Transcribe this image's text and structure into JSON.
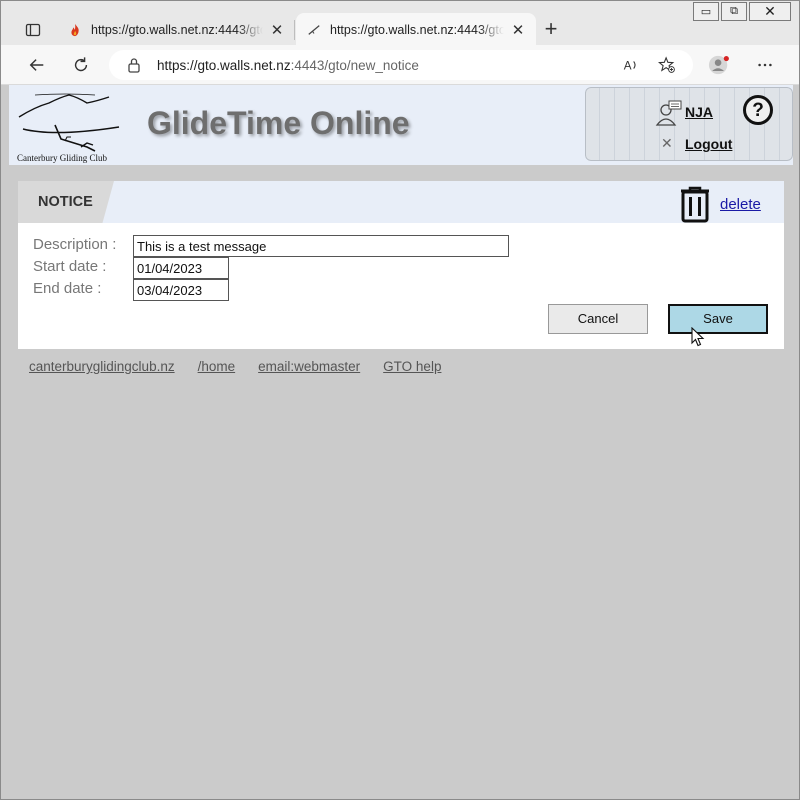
{
  "browser": {
    "tabs": [
      {
        "title": "https://gto.walls.net.nz:4443/gto/",
        "favicon": "flame-icon"
      },
      {
        "title": "https://gto.walls.net.nz:4443/gto/",
        "favicon": "glider-icon"
      }
    ],
    "url_main": "https://gto.walls.net.nz",
    "url_rest": ":4443/gto/new_notice",
    "window_buttons": {
      "minimize": "▭",
      "restore": "⧉",
      "close": "✕"
    }
  },
  "header": {
    "logo_text": "Canterbury Gliding Club",
    "site_title": "GlideTime Online",
    "username": "NJA",
    "logout_label": "Logout",
    "help_label": "?"
  },
  "notice": {
    "section_title": "NOTICE",
    "delete_label": "delete",
    "fields": {
      "description_label": "Description :",
      "description_value": "This is a test message",
      "start_label": "Start date :",
      "start_value": "01/04/2023",
      "end_label": "End date :",
      "end_value": "03/04/2023"
    },
    "cancel_label": "Cancel",
    "save_label": "Save"
  },
  "footer": {
    "links": [
      "canterburyglidingclub.nz",
      "/home",
      "email:webmaster",
      "GTO help"
    ]
  },
  "colors": {
    "header_bg": "#e8eef8",
    "save_bg": "#add8e6",
    "page_bg": "#cbcbcb",
    "link": "#1a1aa6"
  }
}
